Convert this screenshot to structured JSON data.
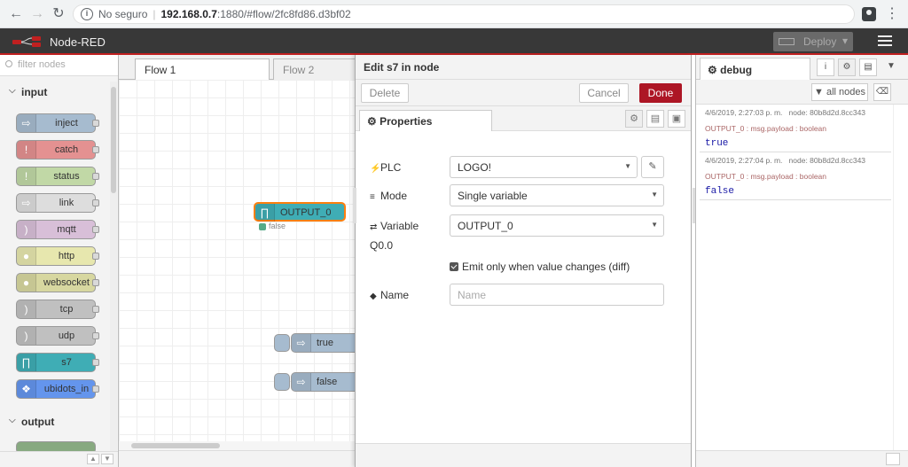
{
  "browser": {
    "security_label": "No seguro",
    "url_host": "192.168.0.7",
    "url_rest": ":1880/#flow/2fc8fd86.d3bf02"
  },
  "app": {
    "title": "Node-RED",
    "deploy_label": "Deploy"
  },
  "palette": {
    "search_placeholder": "filter nodes",
    "categories": [
      {
        "label": "input"
      },
      {
        "label": "output"
      }
    ],
    "nodes": [
      {
        "label": "inject",
        "color": "#a6bbcf",
        "icon": "arrow-in-icon"
      },
      {
        "label": "catch",
        "color": "#e49191",
        "icon": "exclamation-icon"
      },
      {
        "label": "status",
        "color": "#94c1d0",
        "icon": "exclamation-icon"
      },
      {
        "label": "link",
        "color": "#dddddd",
        "icon": "link-icon"
      },
      {
        "label": "mqtt",
        "color": "#d8bfd8",
        "icon": "bridge-icon"
      },
      {
        "label": "http",
        "color": "#e7e7ae",
        "icon": "globe-icon"
      },
      {
        "label": "websocket",
        "color": "#d7d7a0",
        "icon": "globe-icon"
      },
      {
        "label": "tcp",
        "color": "#c0c0c0",
        "icon": "bridge-icon"
      },
      {
        "label": "udp",
        "color": "#c0c0c0",
        "icon": "bridge-icon"
      },
      {
        "label": "s7",
        "color": "#3fadb5",
        "icon": "s7-icon"
      },
      {
        "label": "ubidots_in",
        "color": "#6495ed",
        "icon": "ubidots-icon"
      }
    ]
  },
  "workspace": {
    "tabs": [
      {
        "label": "Flow 1"
      },
      {
        "label": "Flow 2"
      }
    ],
    "nodes": [
      {
        "label": "OUTPUT_0",
        "status": "false",
        "color": "#3fadb5"
      },
      {
        "label": "true",
        "color": "#a6bbcf"
      },
      {
        "label": "false",
        "color": "#a6bbcf"
      }
    ]
  },
  "tray": {
    "title": "Edit s7 in node",
    "delete_label": "Delete",
    "cancel_label": "Cancel",
    "done_label": "Done",
    "tab_label": "Properties",
    "fields": {
      "plc_label": "PLC",
      "plc_value": "LOGO!",
      "mode_label": "Mode",
      "mode_value": "Single variable",
      "variable_label": "Variable",
      "variable_sub": "Q0.0",
      "variable_value": "OUTPUT_0",
      "emit_label": "Emit only when value changes (diff)",
      "name_label": "Name",
      "name_placeholder": "Name"
    }
  },
  "sidebar": {
    "tab_label": "debug",
    "all_nodes_label": "all nodes",
    "messages": [
      {
        "timestamp": "4/6/2019, 2:27:03 p. m.",
        "node": "node: 80b8d2d.8cc343",
        "topic": "OUTPUT_0 : msg.payload : boolean",
        "value": "true"
      },
      {
        "timestamp": "4/6/2019, 2:27:04 p. m.",
        "node": "node: 80b8d2d.8cc343",
        "topic": "OUTPUT_0 : msg.payload : boolean",
        "value": "false"
      }
    ]
  },
  "colors": {
    "accent": "#ad1625",
    "header": "#383838"
  }
}
